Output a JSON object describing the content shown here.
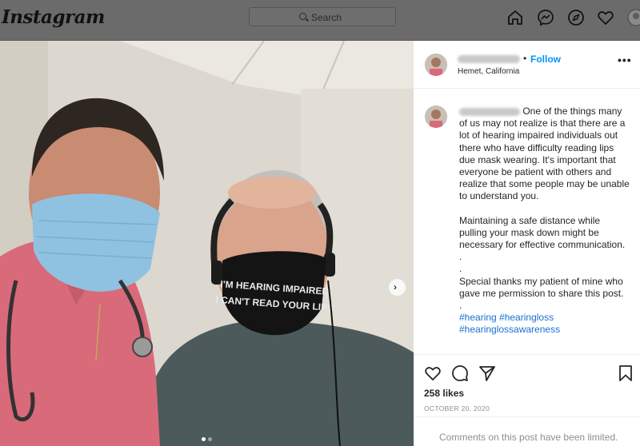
{
  "nav": {
    "logo": "Instagram",
    "search_placeholder": "Search",
    "icons": [
      "home-icon",
      "messenger-icon",
      "explore-icon",
      "heart-icon",
      "avatar"
    ]
  },
  "photo": {
    "mask_line1": "I'M HEARING IMPAIRED",
    "mask_line2": "I CAN'T READ YOUR LIPS",
    "carousel_dots": 2,
    "active_dot": 0
  },
  "post": {
    "follow_label": "Follow",
    "bullet": "•",
    "location": "Hemet, California",
    "more": "•••",
    "caption_paragraphs": [
      "One of the things many of us may not realize is that there are a lot of hearing impaired individuals out there who have difficulty reading lips due mask wearing. It's important that everyone be patient with others and realize that some people may be unable to understand you.",
      "Maintaining a safe distance while pulling your mask down might be necessary for effective communication.",
      ".",
      ".",
      "Special thanks my patient of mine who gave me permission to share this post.",
      "."
    ],
    "hashtags_line1": "#hearing #hearingloss",
    "hashtags_line2": "#hearinglossawareness",
    "likes": "258 likes",
    "date": "OCTOBER 20, 2020",
    "comments_limited": "Comments on this post have been limited."
  },
  "colors": {
    "accent": "#0095f6",
    "overlay": "#6b6b6b",
    "muted": "#8e8e8e"
  }
}
